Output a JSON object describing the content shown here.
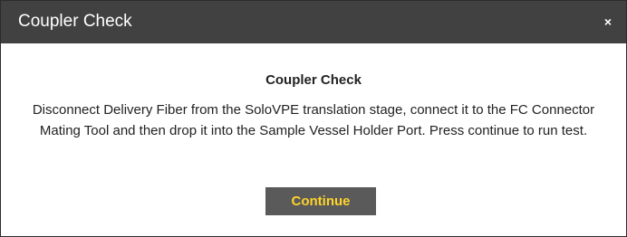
{
  "dialog": {
    "title": "Coupler Check",
    "close_icon_glyph": "×",
    "close_icon": "close-icon",
    "heading": "Coupler Check",
    "message": "Disconnect Delivery Fiber from the SoloVPE translation stage, connect it to the FC Connector Mating Tool and then drop it into the Sample Vessel Holder Port. Press continue to run test.",
    "continue_label": "Continue"
  },
  "colors": {
    "titlebar_bg": "#414141",
    "title_text": "#ffffff",
    "button_bg": "#5a5a5a",
    "button_text": "#ffd42a",
    "body_text": "#222222"
  }
}
